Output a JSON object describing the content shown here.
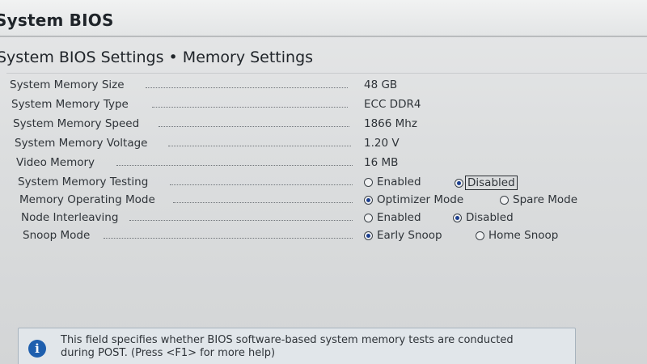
{
  "window": {
    "title": "System BIOS"
  },
  "page": {
    "breadcrumb": "System BIOS Settings • Memory Settings"
  },
  "settings": [
    {
      "label": "System Memory Size",
      "value": "48 GB"
    },
    {
      "label": "System Memory Type",
      "value": "ECC DDR4"
    },
    {
      "label": "System Memory Speed",
      "value": "1866 Mhz"
    },
    {
      "label": "System Memory Voltage",
      "value": "1.20 V"
    },
    {
      "label": "Video Memory",
      "value": "16 MB"
    },
    {
      "label": "System Memory Testing",
      "options": [
        "Enabled",
        "Disabled"
      ],
      "selected": "Disabled"
    },
    {
      "label": "Memory Operating Mode",
      "options": [
        "Optimizer Mode",
        "Spare Mode"
      ],
      "selected": "Optimizer Mode"
    },
    {
      "label": "Node Interleaving",
      "options": [
        "Enabled",
        "Disabled"
      ],
      "selected": "Disabled"
    },
    {
      "label": "Snoop Mode",
      "options": [
        "Early Snoop",
        "Home Snoop"
      ],
      "selected": "Early Snoop"
    }
  ],
  "help": {
    "icon": "info-icon",
    "line1": "This field specifies whether BIOS software-based system memory tests are conducted",
    "line2": "during POST. (Press <F1> for more help)"
  },
  "colors": {
    "radio_selected": "#1c3f8f",
    "info_icon": "#1e5fae"
  }
}
